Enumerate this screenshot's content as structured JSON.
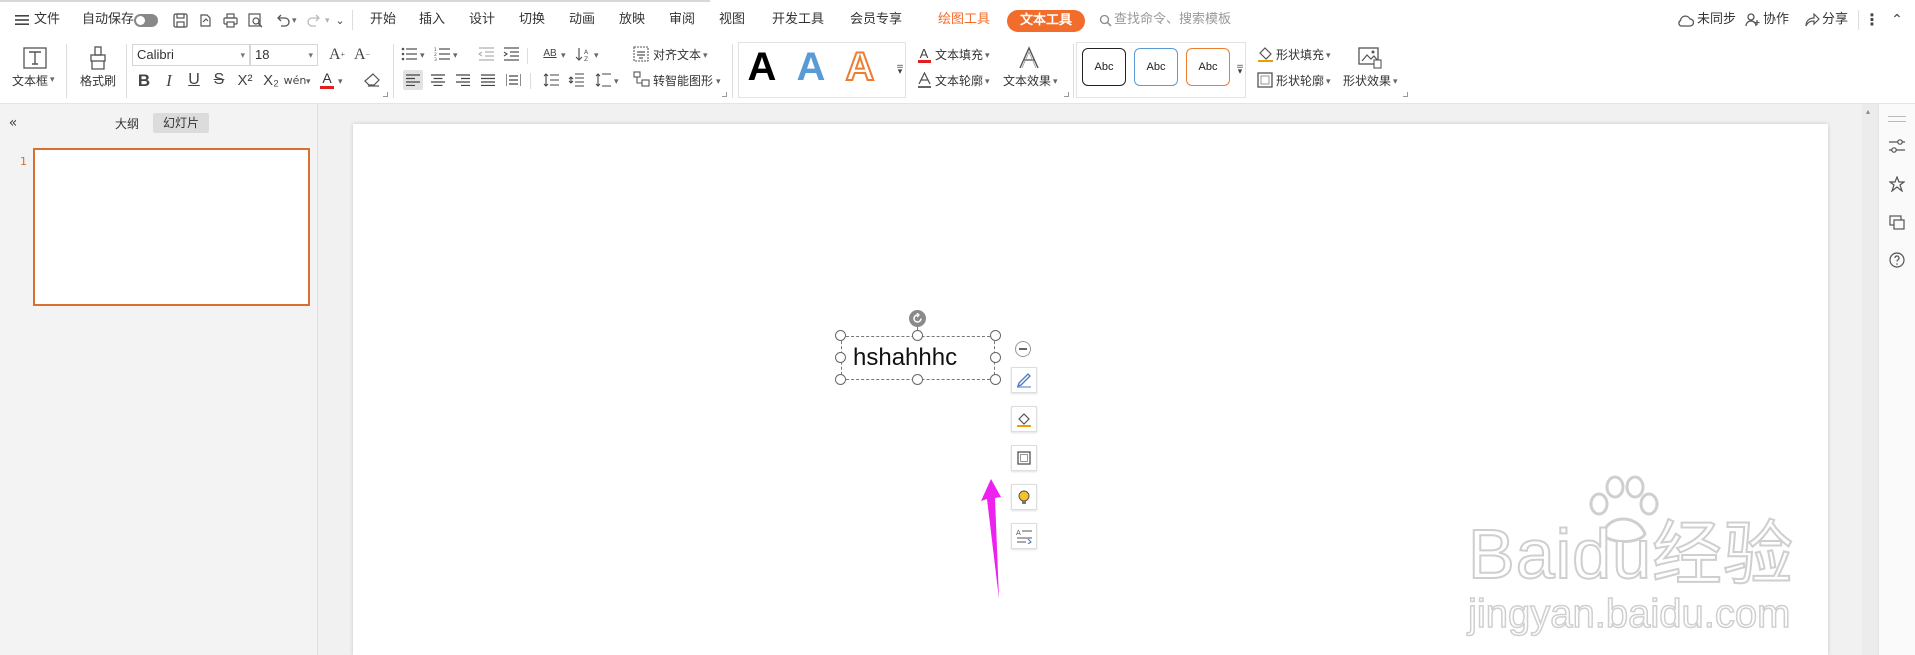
{
  "menubar": {
    "file_label": "文件",
    "autosave_label": "自动保存",
    "tabs": [
      "开始",
      "插入",
      "设计",
      "切换",
      "动画",
      "放映",
      "审阅",
      "视图",
      "开发工具",
      "会员专享"
    ],
    "drawing_tools": "绘图工具",
    "text_tools": "文本工具",
    "search_placeholder": "查找命令、搜索模板",
    "sync_label": "未同步",
    "collab_label": "协作",
    "share_label": "分享"
  },
  "ribbon": {
    "textbox_label": "文本框",
    "format_painter_label": "格式刷",
    "font_name": "Calibri",
    "font_size": "18",
    "align_text_label": "对齐文本",
    "smartart_label": "转智能图形",
    "text_fill_label": "文本填充",
    "text_outline_label": "文本轮廓",
    "text_effect_label": "文本效果",
    "abc_label": "Abc",
    "shape_fill_label": "形状填充",
    "shape_outline_label": "形状轮廓",
    "shape_effect_label": "形状效果",
    "bigA": "A",
    "font_color_letter": "A",
    "bold": "B",
    "italic": "I",
    "underline": "U",
    "strike": "S",
    "sup": "X²",
    "sub": "X₂"
  },
  "left_panel": {
    "outline_tab": "大纲",
    "slides_tab": "幻灯片",
    "slide_number": "1"
  },
  "slide": {
    "textbox_text": "hshahhhc"
  },
  "watermark": {
    "brand": "Baidu经验",
    "url": "jingyan.baidu.com"
  },
  "colors": {
    "accent_orange": "#f26d2b",
    "arrow_magenta": "#ee22ee",
    "style_a_blue": "#5b9bd5",
    "style_a_orange": "#ed7d31"
  }
}
